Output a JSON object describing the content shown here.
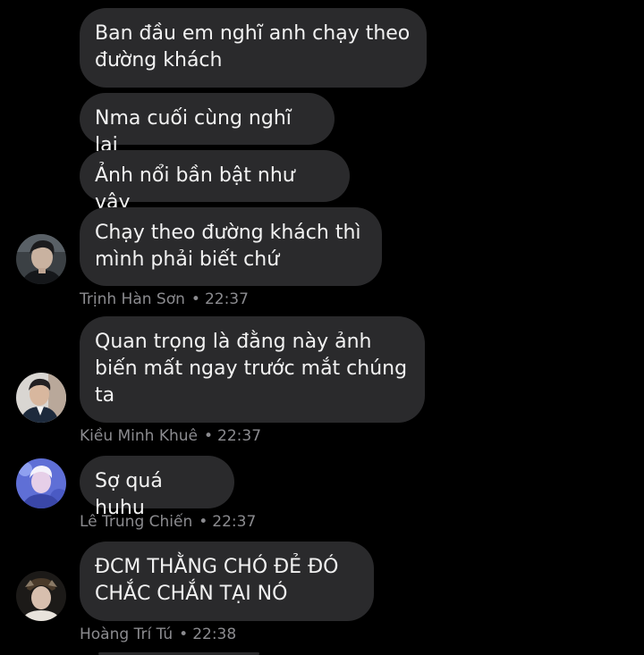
{
  "thread": {
    "groups": [
      {
        "sender": "Trịnh Hàn Sơn",
        "time": "22:37",
        "messages": [
          "Ban đầu em nghĩ anh chạy theo\nđường khách",
          "Nma cuối cùng nghĩ lại",
          "Ảnh nổi bần bật như vậy",
          "Chạy theo đường khách thì\nmình phải biết chứ"
        ]
      },
      {
        "sender": "Kiều Minh Khuê",
        "time": "22:37",
        "messages": [
          "Quan trọng là đằng này ảnh\nbiến mất ngay trước mắt chúng\nta"
        ]
      },
      {
        "sender": "Lê Trung Chiến",
        "time": "22:37",
        "messages": [
          "Sợ quá huhu"
        ]
      },
      {
        "sender": "Hoàng Trí Tú",
        "time": "22:38",
        "messages": [
          "ĐCM THẰNG CHÓ ĐẺ ĐÓ\nCHẮC CHẮN TẠI NÓ"
        ]
      }
    ],
    "separator": "•"
  },
  "colors": {
    "background": "#000000",
    "bubble": "#2a2a2c",
    "bubble_text": "#f2f2f2",
    "meta_text": "#8b8b8f"
  },
  "icons": {
    "avatar_1": "profile-photo-dark-hair-man",
    "avatar_2": "profile-photo-man-in-suit",
    "avatar_3": "profile-photo-blue-tinted",
    "avatar_4": "profile-photo-man-with-hat"
  }
}
